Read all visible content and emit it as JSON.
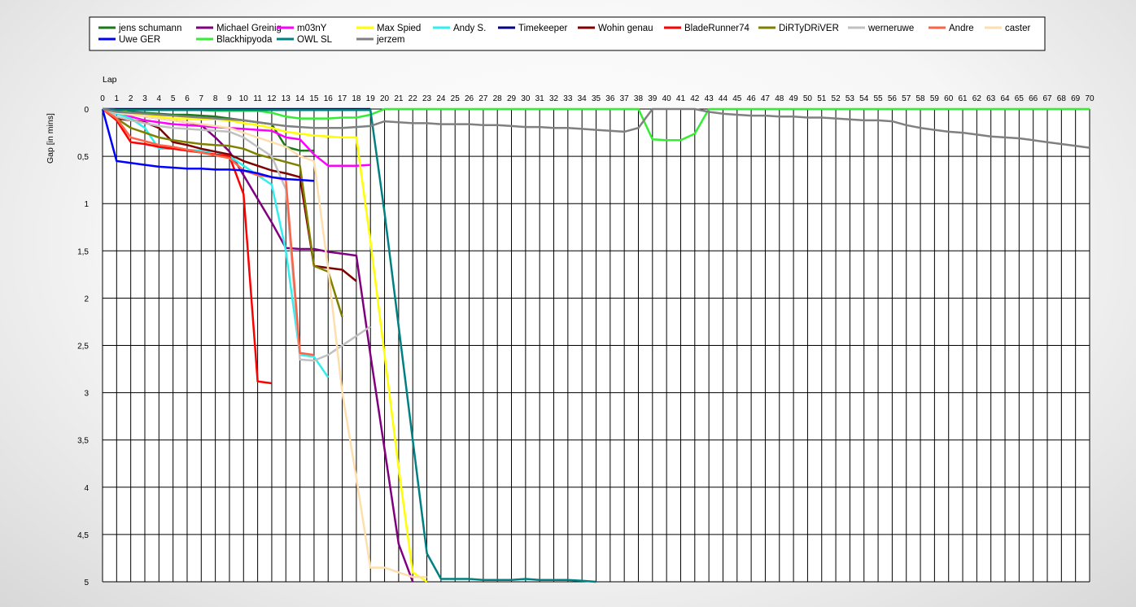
{
  "chart_data": {
    "type": "line",
    "xlabel": "Lap",
    "ylabel": "Gap [in mins]",
    "x_ticks": [
      "0",
      "1",
      "2",
      "3",
      "4",
      "5",
      "6",
      "7",
      "8",
      "9",
      "10",
      "11",
      "12",
      "13",
      "14",
      "15",
      "16",
      "17",
      "18",
      "19",
      "20",
      "21",
      "22",
      "23",
      "24",
      "25",
      "26",
      "27",
      "28",
      "29",
      "30",
      "31",
      "32",
      "33",
      "34",
      "35",
      "36",
      "37",
      "38",
      "39",
      "40",
      "41",
      "42",
      "43",
      "44",
      "45",
      "46",
      "47",
      "48",
      "49",
      "50",
      "51",
      "52",
      "53",
      "54",
      "55",
      "56",
      "57",
      "58",
      "59",
      "60",
      "61",
      "62",
      "63",
      "64",
      "65",
      "66",
      "67",
      "68",
      "69",
      "70"
    ],
    "y_ticks": [
      "0",
      "0,5",
      "1",
      "1,5",
      "2",
      "2,5",
      "3",
      "3,5",
      "4",
      "4,5",
      "5"
    ],
    "xlim": [
      0,
      70
    ],
    "ylim": [
      0,
      5
    ],
    "y_inverted": true,
    "grid": true,
    "legend_position": "top",
    "series": [
      {
        "name": "jens  schumann",
        "color": "#1a7a1a",
        "x": [
          0,
          1,
          2,
          3,
          4,
          5,
          6,
          7,
          8,
          9,
          10,
          11,
          12,
          13,
          14,
          15
        ],
        "y": [
          0,
          0.02,
          0.03,
          0.04,
          0.05,
          0.06,
          0.06,
          0.07,
          0.08,
          0.1,
          0.12,
          0.14,
          0.16,
          0.4,
          0.44,
          0.44
        ]
      },
      {
        "name": "Michael Greinig",
        "color": "#800080",
        "x": [
          0,
          1,
          2,
          3,
          4,
          5,
          6,
          7,
          8,
          9,
          10,
          11,
          12,
          13,
          14,
          15,
          16,
          17,
          18,
          19,
          20,
          21,
          22
        ],
        "y": [
          0,
          0.03,
          0.05,
          0.08,
          0.1,
          0.12,
          0.14,
          0.17,
          0.3,
          0.45,
          0.7,
          0.95,
          1.2,
          1.47,
          1.48,
          1.48,
          1.51,
          1.53,
          1.55,
          2.6,
          3.6,
          4.6,
          5.0
        ]
      },
      {
        "name": "m03nY",
        "color": "#ff00ff",
        "x": [
          0,
          1,
          2,
          3,
          4,
          5,
          6,
          7,
          8,
          9,
          10,
          11,
          12,
          13,
          14,
          15,
          16,
          17,
          18,
          19
        ],
        "y": [
          0,
          0.05,
          0.08,
          0.12,
          0.14,
          0.16,
          0.17,
          0.18,
          0.19,
          0.2,
          0.21,
          0.22,
          0.23,
          0.3,
          0.32,
          0.48,
          0.6,
          0.6,
          0.6,
          0.59
        ]
      },
      {
        "name": "Max Spied",
        "color": "#ffff00",
        "x": [
          0,
          1,
          2,
          3,
          4,
          5,
          6,
          7,
          8,
          9,
          10,
          11,
          12,
          13,
          14,
          15,
          16,
          17,
          18,
          19,
          20,
          21,
          22,
          23
        ],
        "y": [
          0,
          0.02,
          0.04,
          0.06,
          0.08,
          0.1,
          0.1,
          0.11,
          0.11,
          0.12,
          0.15,
          0.17,
          0.2,
          0.24,
          0.26,
          0.28,
          0.29,
          0.3,
          0.3,
          1.4,
          2.6,
          3.8,
          4.9,
          5.0
        ]
      },
      {
        "name": "Andy S.",
        "color": "#33eeee",
        "x": [
          0,
          1,
          2,
          3,
          4,
          5,
          6,
          7,
          8,
          9,
          10,
          11,
          12,
          13,
          14,
          15,
          16
        ],
        "y": [
          0,
          0.05,
          0.1,
          0.2,
          0.42,
          0.42,
          0.43,
          0.44,
          0.45,
          0.5,
          0.6,
          0.7,
          0.8,
          1.5,
          2.6,
          2.62,
          2.84
        ]
      },
      {
        "name": "Timekeeper",
        "color": "#000080",
        "x": [
          0,
          1,
          2,
          3,
          4,
          5,
          6,
          7,
          8,
          9,
          10,
          11,
          12,
          13,
          14,
          15,
          16,
          17,
          18,
          19
        ],
        "y": [
          0,
          0,
          0,
          0,
          0,
          0,
          0,
          0,
          0,
          0,
          0,
          0,
          0,
          0,
          0,
          0,
          0,
          0,
          0,
          0
        ]
      },
      {
        "name": "Wohin genau",
        "color": "#800000",
        "x": [
          0,
          1,
          2,
          3,
          4,
          5,
          6,
          7,
          8,
          9,
          10,
          11,
          12,
          13,
          14,
          15,
          16,
          17,
          18
        ],
        "y": [
          0,
          0.1,
          0.12,
          0.14,
          0.2,
          0.35,
          0.38,
          0.42,
          0.45,
          0.48,
          0.55,
          0.6,
          0.65,
          0.68,
          0.72,
          1.66,
          1.68,
          1.7,
          1.82
        ]
      },
      {
        "name": "BladeRunner74",
        "color": "#ff0000",
        "x": [
          0,
          1,
          2,
          3,
          4,
          5,
          6,
          7,
          8,
          9,
          10,
          11,
          12
        ],
        "y": [
          0,
          0.12,
          0.35,
          0.37,
          0.4,
          0.42,
          0.44,
          0.46,
          0.48,
          0.5,
          0.9,
          2.88,
          2.9
        ]
      },
      {
        "name": "DiRTyDRiVER",
        "color": "#808000",
        "x": [
          0,
          1,
          2,
          3,
          4,
          5,
          6,
          7,
          8,
          9,
          10,
          11,
          12,
          13,
          14,
          15,
          16,
          17
        ],
        "y": [
          0,
          0.1,
          0.2,
          0.25,
          0.3,
          0.33,
          0.35,
          0.37,
          0.38,
          0.39,
          0.42,
          0.48,
          0.52,
          0.56,
          0.6,
          1.66,
          1.72,
          2.2
        ]
      },
      {
        "name": "werneruwe",
        "color": "#c0c0c0",
        "x": [
          0,
          1,
          2,
          3,
          4,
          5,
          6,
          7,
          8,
          9,
          10,
          11,
          12,
          13,
          14,
          15,
          16,
          17,
          18,
          19
        ],
        "y": [
          0,
          0.08,
          0.12,
          0.15,
          0.18,
          0.2,
          0.21,
          0.22,
          0.23,
          0.24,
          0.3,
          0.4,
          0.5,
          0.85,
          2.65,
          2.66,
          2.6,
          2.5,
          2.4,
          2.3
        ]
      },
      {
        "name": "Andre",
        "color": "#ff6347",
        "x": [
          0,
          1,
          2,
          3,
          4,
          5,
          6,
          7,
          8,
          9,
          10,
          11,
          12,
          13,
          14,
          15
        ],
        "y": [
          0,
          0.1,
          0.3,
          0.34,
          0.38,
          0.4,
          0.43,
          0.46,
          0.49,
          0.52,
          0.65,
          0.7,
          0.72,
          0.75,
          2.58,
          2.6
        ]
      },
      {
        "name": "caster",
        "color": "#ffdead",
        "x": [
          0,
          1,
          2,
          3,
          4,
          5,
          6,
          7,
          8,
          9,
          10,
          11,
          12,
          13,
          14,
          15,
          16,
          17,
          18,
          19,
          20,
          21,
          22,
          23
        ],
        "y": [
          0,
          0.04,
          0.06,
          0.08,
          0.1,
          0.12,
          0.14,
          0.16,
          0.18,
          0.2,
          0.25,
          0.3,
          0.35,
          0.4,
          0.5,
          0.55,
          1.7,
          3.0,
          3.9,
          4.85,
          4.85,
          4.9,
          4.95,
          4.95
        ]
      },
      {
        "name": "Uwe GER",
        "color": "#0000ff",
        "x": [
          0,
          1,
          2,
          3,
          4,
          5,
          6,
          7,
          8,
          9,
          10,
          11,
          12,
          13,
          14,
          15
        ],
        "y": [
          0,
          0.55,
          0.57,
          0.59,
          0.61,
          0.62,
          0.63,
          0.63,
          0.64,
          0.64,
          0.65,
          0.68,
          0.72,
          0.74,
          0.75,
          0.76
        ]
      },
      {
        "name": "Blackhipyoda",
        "color": "#33ee33",
        "x": [
          0,
          1,
          2,
          3,
          4,
          5,
          6,
          7,
          8,
          9,
          10,
          11,
          12,
          13,
          14,
          15,
          16,
          17,
          18,
          19,
          20,
          21,
          22,
          23,
          24,
          25,
          26,
          27,
          28,
          29,
          30,
          31,
          32,
          33,
          34,
          35,
          36,
          37,
          38,
          39,
          40,
          41,
          42,
          43,
          44,
          45,
          46,
          47,
          48,
          49,
          50,
          51,
          52,
          53,
          54,
          55,
          56,
          57,
          58,
          59,
          60,
          61,
          62,
          63,
          64,
          65,
          66,
          67,
          68,
          69,
          70
        ],
        "y": [
          0,
          0.01,
          0.01,
          0.01,
          0.01,
          0.01,
          0.01,
          0.01,
          0.02,
          0.02,
          0.02,
          0.02,
          0.04,
          0.08,
          0.1,
          0.1,
          0.1,
          0.09,
          0.09,
          0.06,
          0,
          0,
          0,
          0,
          0,
          0,
          0,
          0,
          0,
          0,
          0,
          0,
          0,
          0,
          0,
          0,
          0,
          0,
          0,
          0.32,
          0.33,
          0.33,
          0.26,
          0,
          0,
          0,
          0,
          0,
          0,
          0,
          0,
          0,
          0,
          0,
          0,
          0,
          0,
          0,
          0,
          0,
          0,
          0,
          0,
          0,
          0,
          0,
          0,
          0,
          0,
          0,
          0
        ]
      },
      {
        "name": "OWL SL",
        "color": "#008080",
        "x": [
          0,
          1,
          2,
          3,
          4,
          5,
          6,
          7,
          8,
          9,
          10,
          11,
          12,
          13,
          14,
          15,
          16,
          17,
          18,
          19,
          20,
          21,
          22,
          23,
          24,
          25,
          26,
          27,
          28,
          29,
          30,
          31,
          32,
          33,
          34,
          35
        ],
        "y": [
          0,
          0.01,
          0.01,
          0.01,
          0.01,
          0.01,
          0.01,
          0.01,
          0.01,
          0.01,
          0.01,
          0.01,
          0.01,
          0.01,
          0.01,
          0.01,
          0.01,
          0.01,
          0.01,
          0.01,
          1.1,
          2.3,
          3.5,
          4.7,
          4.97,
          4.97,
          4.97,
          4.98,
          4.98,
          4.98,
          4.97,
          4.98,
          4.98,
          4.98,
          4.99,
          5.0
        ]
      },
      {
        "name": "jerzem",
        "color": "#808080",
        "x": [
          0,
          1,
          2,
          3,
          4,
          5,
          6,
          7,
          8,
          9,
          10,
          11,
          12,
          13,
          14,
          15,
          16,
          17,
          18,
          19,
          20,
          21,
          22,
          23,
          24,
          25,
          26,
          27,
          28,
          29,
          30,
          31,
          32,
          33,
          34,
          35,
          36,
          37,
          38,
          39,
          40,
          41,
          42,
          43,
          44,
          45,
          46,
          47,
          48,
          49,
          50,
          51,
          52,
          53,
          54,
          55,
          56,
          57,
          58,
          59,
          60,
          61,
          62,
          63,
          64,
          65,
          66,
          67,
          68,
          69,
          70
        ],
        "y": [
          0,
          0.03,
          0.04,
          0.05,
          0.06,
          0.07,
          0.08,
          0.09,
          0.1,
          0.11,
          0.12,
          0.14,
          0.16,
          0.18,
          0.19,
          0.2,
          0.2,
          0.2,
          0.19,
          0.18,
          0.13,
          0.14,
          0.15,
          0.15,
          0.16,
          0.16,
          0.16,
          0.17,
          0.17,
          0.18,
          0.19,
          0.19,
          0.2,
          0.2,
          0.21,
          0.22,
          0.23,
          0.24,
          0.2,
          0,
          0,
          0,
          0,
          0.03,
          0.05,
          0.06,
          0.07,
          0.07,
          0.08,
          0.08,
          0.09,
          0.09,
          0.1,
          0.11,
          0.12,
          0.12,
          0.13,
          0.17,
          0.2,
          0.22,
          0.24,
          0.25,
          0.27,
          0.29,
          0.3,
          0.31,
          0.33,
          0.35,
          0.37,
          0.39,
          0.41
        ]
      }
    ]
  }
}
